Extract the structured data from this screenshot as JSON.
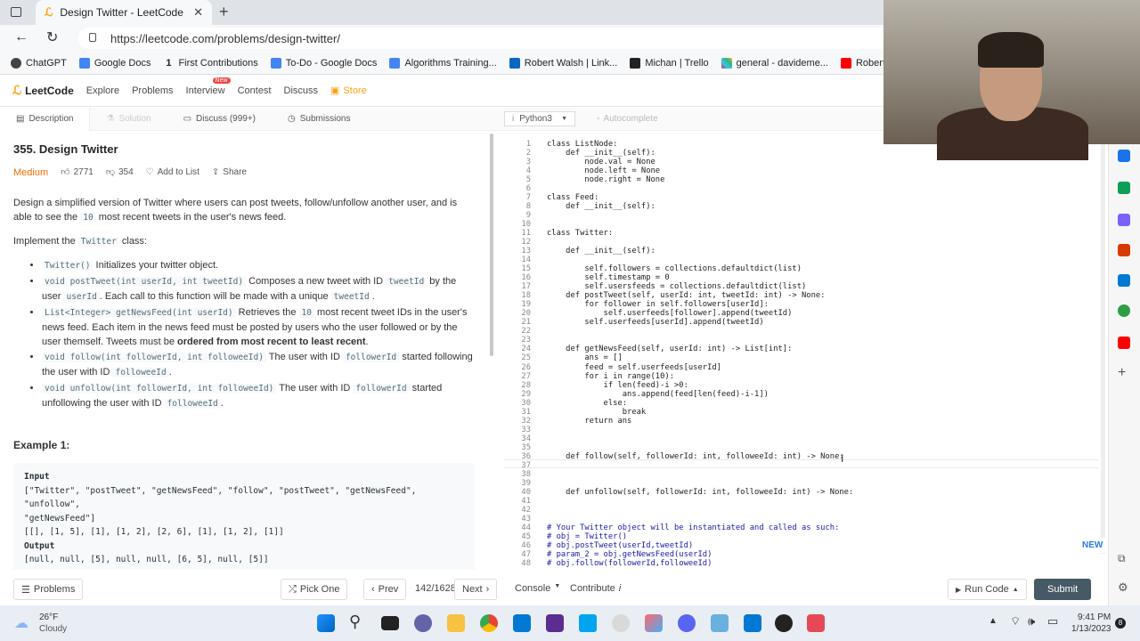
{
  "browser": {
    "tab_title": "Design Twitter - LeetCode",
    "url": "https://leetcode.com/problems/design-twitter/",
    "bookmarks": [
      "ChatGPT",
      "Google Docs",
      "First Contributions",
      "To-Do - Google Docs",
      "Algorithms Training...",
      "Robert Walsh | Link...",
      "Michan | Trello",
      "general - davideme...",
      "Robert W. - Live C"
    ]
  },
  "nav": {
    "logo": "LeetCode",
    "items": [
      "Explore",
      "Problems",
      "Interview",
      "Contest",
      "Discuss",
      "Store"
    ],
    "badge": "New"
  },
  "tabs": {
    "description": "Description",
    "solution": "Solution",
    "discuss": "Discuss (999+)",
    "submissions": "Submissions",
    "language": "Python3",
    "autocomplete": "Autocomplete"
  },
  "problem": {
    "title": "355. Design Twitter",
    "difficulty": "Medium",
    "likes": "2771",
    "dislikes": "354",
    "add_to_list": "Add to List",
    "share": "Share",
    "desc1a": "Design a simplified version of Twitter where users can post tweets, follow/unfollow another user, and is able to see the ",
    "desc1code": "10",
    "desc1b": " most recent tweets in the user's news feed.",
    "impl_a": "Implement the ",
    "impl_code": "Twitter",
    "impl_b": " class:",
    "b1code": "Twitter()",
    "b1text": " Initializes your twitter object.",
    "b2code": "void postTweet(int userId, int tweetId)",
    "b2text": " Composes a new tweet with ID ",
    "b2code2": "tweetId",
    "b2text2": " by the user ",
    "b2code3": "userId",
    "b2text3": ". Each call to this function will be made with a unique ",
    "b2code4": "tweetId",
    "b2text4": ".",
    "b3code": "List<Integer> getNewsFeed(int userId)",
    "b3text": " Retrieves the ",
    "b3code2": "10",
    "b3text2": " most recent tweet IDs in the user's news feed. Each item in the news feed must be posted by users who the user followed or by the user themself. Tweets must be ",
    "b3bold": "ordered from most recent to least recent",
    "b3text3": ".",
    "b4code": "void follow(int followerId, int followeeId)",
    "b4text": " The user with ID ",
    "b4code2": "followerId",
    "b4text2": " started following the user with ID ",
    "b4code3": "followeeId",
    "b4text3": ".",
    "b5code": "void unfollow(int followerId, int followeeId)",
    "b5text": " The user with ID ",
    "b5code2": "followerId",
    "b5text2": " started unfollowing the user with ID ",
    "b5code3": "followeeId",
    "b5text3": ".",
    "example_title": "Example 1:",
    "input_label": "Input",
    "input_line1": "[\"Twitter\", \"postTweet\", \"getNewsFeed\", \"follow\", \"postTweet\", \"getNewsFeed\", \"unfollow\",",
    "input_line2": "\"getNewsFeed\"]",
    "input_line3": "[[], [1, 5], [1], [1, 2], [2, 6], [1], [1, 2], [1]]",
    "output_label": "Output",
    "output_line": "[null, null, [5], null, null, [6, 5], null, [5]]"
  },
  "code": [
    "class ListNode:",
    "    def __init__(self):",
    "        node.val = None",
    "        node.left = None",
    "        node.right = None",
    "",
    "class Feed:",
    "    def __init__(self):",
    "",
    "",
    "class Twitter:",
    "",
    "    def __init__(self):",
    "",
    "        self.followers = collections.defaultdict(list)",
    "        self.timestamp = 0",
    "        self.usersfeeds = collections.defaultdict(list)",
    "    def postTweet(self, userId: int, tweetId: int) -> None:",
    "        for follower in self.followers[userId]:",
    "            self.userfeeds[follower].append(tweetId)",
    "        self.userfeeds[userId].append(tweetId)",
    "",
    "",
    "    def getNewsFeed(self, userId: int) -> List[int]:",
    "        ans = []",
    "        feed = self.userfeeds[userId]",
    "        for i in range(10):",
    "            if len(feed)-i >0:",
    "                ans.append(feed[len(feed)-i-1])",
    "            else:",
    "                break",
    "        return ans",
    "",
    "",
    "",
    "    def follow(self, followerId: int, followeeId: int) -> None:",
    "",
    "",
    "",
    "    def unfollow(self, followerId: int, followeeId: int) -> None:",
    "",
    "",
    "",
    "# Your Twitter object will be instantiated and called as such:",
    "# obj = Twitter()",
    "# obj.postTweet(userId,tweetId)",
    "# param_2 = obj.getNewsFeed(userId)",
    "# obj.follow(followerId,followeeId)"
  ],
  "bottom": {
    "problems": "Problems",
    "pick_one": "Pick One",
    "prev": "Prev",
    "counter": "142/1628",
    "next": "Next",
    "console": "Console",
    "contribute": "Contribute",
    "run_code": "Run Code",
    "submit": "Submit",
    "new_badge": "NEW"
  },
  "taskbar": {
    "temp": "26°F",
    "weather": "Cloudy",
    "time": "9:41 PM",
    "date": "1/13/2023"
  },
  "colors": {
    "accent": "#ffa116",
    "medium": "#ef6c00",
    "submit": "#455a64"
  }
}
